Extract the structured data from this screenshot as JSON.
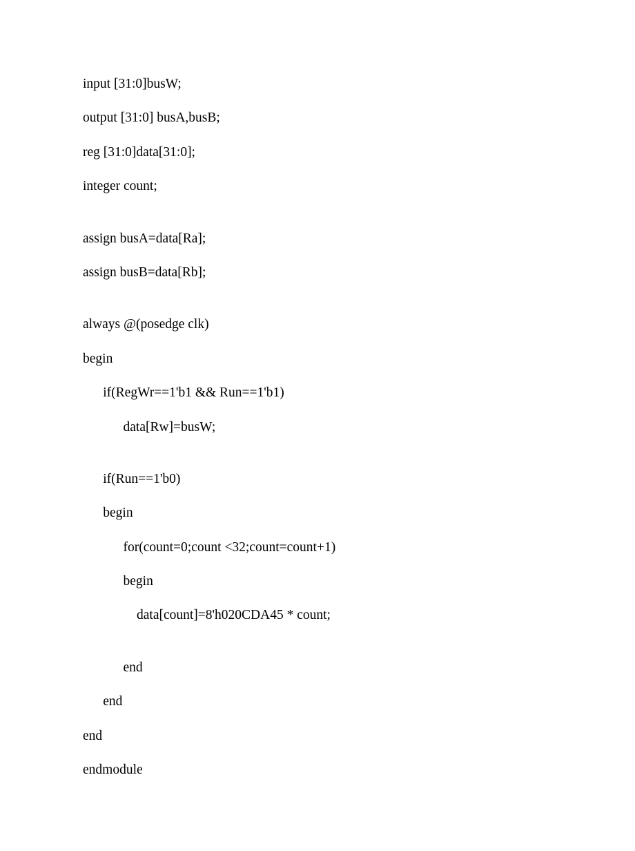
{
  "code": {
    "lines": [
      "input [31:0]busW;",
      "output [31:0] busA,busB;",
      "reg [31:0]data[31:0];",
      "integer count;",
      "",
      "assign busA=data[Ra];",
      "assign busB=data[Rb];",
      "",
      "always @(posedge clk)",
      "begin",
      "      if(RegWr==1'b1 && Run==1'b1)",
      "            data[Rw]=busW;",
      "",
      "      if(Run==1'b0)",
      "      begin",
      "            for(count=0;count <32;count=count+1)",
      "            begin",
      "                data[count]=8'h020CDA45 * count;",
      "",
      "            end",
      "      end",
      "end",
      "endmodule"
    ]
  }
}
